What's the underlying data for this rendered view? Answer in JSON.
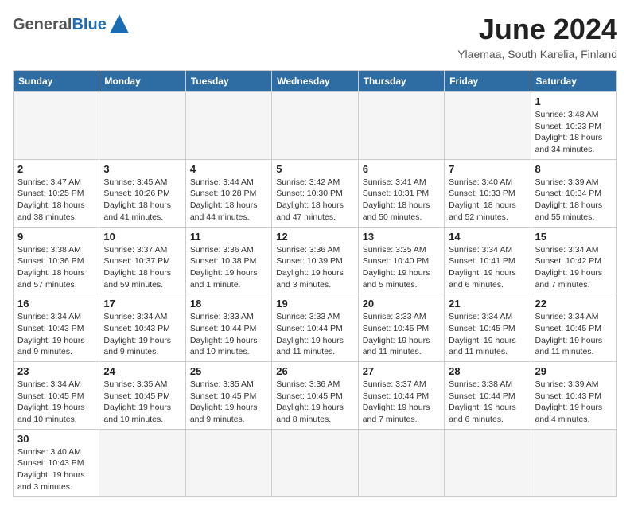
{
  "header": {
    "month_year": "June 2024",
    "location": "Ylaemaa, South Karelia, Finland",
    "logo_general": "General",
    "logo_blue": "Blue"
  },
  "weekdays": [
    "Sunday",
    "Monday",
    "Tuesday",
    "Wednesday",
    "Thursday",
    "Friday",
    "Saturday"
  ],
  "days": [
    {
      "day": "",
      "sunrise": "",
      "sunset": "",
      "daylight": "",
      "empty": true
    },
    {
      "day": "",
      "sunrise": "",
      "sunset": "",
      "daylight": "",
      "empty": true
    },
    {
      "day": "",
      "sunrise": "",
      "sunset": "",
      "daylight": "",
      "empty": true
    },
    {
      "day": "",
      "sunrise": "",
      "sunset": "",
      "daylight": "",
      "empty": true
    },
    {
      "day": "",
      "sunrise": "",
      "sunset": "",
      "daylight": "",
      "empty": true
    },
    {
      "day": "",
      "sunrise": "",
      "sunset": "",
      "daylight": "",
      "empty": true
    },
    {
      "day": "1",
      "sunrise": "Sunrise: 3:48 AM",
      "sunset": "Sunset: 10:23 PM",
      "daylight": "Daylight: 18 hours and 34 minutes.",
      "empty": false
    },
    {
      "day": "2",
      "sunrise": "Sunrise: 3:47 AM",
      "sunset": "Sunset: 10:25 PM",
      "daylight": "Daylight: 18 hours and 38 minutes.",
      "empty": false
    },
    {
      "day": "3",
      "sunrise": "Sunrise: 3:45 AM",
      "sunset": "Sunset: 10:26 PM",
      "daylight": "Daylight: 18 hours and 41 minutes.",
      "empty": false
    },
    {
      "day": "4",
      "sunrise": "Sunrise: 3:44 AM",
      "sunset": "Sunset: 10:28 PM",
      "daylight": "Daylight: 18 hours and 44 minutes.",
      "empty": false
    },
    {
      "day": "5",
      "sunrise": "Sunrise: 3:42 AM",
      "sunset": "Sunset: 10:30 PM",
      "daylight": "Daylight: 18 hours and 47 minutes.",
      "empty": false
    },
    {
      "day": "6",
      "sunrise": "Sunrise: 3:41 AM",
      "sunset": "Sunset: 10:31 PM",
      "daylight": "Daylight: 18 hours and 50 minutes.",
      "empty": false
    },
    {
      "day": "7",
      "sunrise": "Sunrise: 3:40 AM",
      "sunset": "Sunset: 10:33 PM",
      "daylight": "Daylight: 18 hours and 52 minutes.",
      "empty": false
    },
    {
      "day": "8",
      "sunrise": "Sunrise: 3:39 AM",
      "sunset": "Sunset: 10:34 PM",
      "daylight": "Daylight: 18 hours and 55 minutes.",
      "empty": false
    },
    {
      "day": "9",
      "sunrise": "Sunrise: 3:38 AM",
      "sunset": "Sunset: 10:36 PM",
      "daylight": "Daylight: 18 hours and 57 minutes.",
      "empty": false
    },
    {
      "day": "10",
      "sunrise": "Sunrise: 3:37 AM",
      "sunset": "Sunset: 10:37 PM",
      "daylight": "Daylight: 18 hours and 59 minutes.",
      "empty": false
    },
    {
      "day": "11",
      "sunrise": "Sunrise: 3:36 AM",
      "sunset": "Sunset: 10:38 PM",
      "daylight": "Daylight: 19 hours and 1 minute.",
      "empty": false
    },
    {
      "day": "12",
      "sunrise": "Sunrise: 3:36 AM",
      "sunset": "Sunset: 10:39 PM",
      "daylight": "Daylight: 19 hours and 3 minutes.",
      "empty": false
    },
    {
      "day": "13",
      "sunrise": "Sunrise: 3:35 AM",
      "sunset": "Sunset: 10:40 PM",
      "daylight": "Daylight: 19 hours and 5 minutes.",
      "empty": false
    },
    {
      "day": "14",
      "sunrise": "Sunrise: 3:34 AM",
      "sunset": "Sunset: 10:41 PM",
      "daylight": "Daylight: 19 hours and 6 minutes.",
      "empty": false
    },
    {
      "day": "15",
      "sunrise": "Sunrise: 3:34 AM",
      "sunset": "Sunset: 10:42 PM",
      "daylight": "Daylight: 19 hours and 7 minutes.",
      "empty": false
    },
    {
      "day": "16",
      "sunrise": "Sunrise: 3:34 AM",
      "sunset": "Sunset: 10:43 PM",
      "daylight": "Daylight: 19 hours and 9 minutes.",
      "empty": false
    },
    {
      "day": "17",
      "sunrise": "Sunrise: 3:34 AM",
      "sunset": "Sunset: 10:43 PM",
      "daylight": "Daylight: 19 hours and 9 minutes.",
      "empty": false
    },
    {
      "day": "18",
      "sunrise": "Sunrise: 3:33 AM",
      "sunset": "Sunset: 10:44 PM",
      "daylight": "Daylight: 19 hours and 10 minutes.",
      "empty": false
    },
    {
      "day": "19",
      "sunrise": "Sunrise: 3:33 AM",
      "sunset": "Sunset: 10:44 PM",
      "daylight": "Daylight: 19 hours and 11 minutes.",
      "empty": false
    },
    {
      "day": "20",
      "sunrise": "Sunrise: 3:33 AM",
      "sunset": "Sunset: 10:45 PM",
      "daylight": "Daylight: 19 hours and 11 minutes.",
      "empty": false
    },
    {
      "day": "21",
      "sunrise": "Sunrise: 3:34 AM",
      "sunset": "Sunset: 10:45 PM",
      "daylight": "Daylight: 19 hours and 11 minutes.",
      "empty": false
    },
    {
      "day": "22",
      "sunrise": "Sunrise: 3:34 AM",
      "sunset": "Sunset: 10:45 PM",
      "daylight": "Daylight: 19 hours and 11 minutes.",
      "empty": false
    },
    {
      "day": "23",
      "sunrise": "Sunrise: 3:34 AM",
      "sunset": "Sunset: 10:45 PM",
      "daylight": "Daylight: 19 hours and 10 minutes.",
      "empty": false
    },
    {
      "day": "24",
      "sunrise": "Sunrise: 3:35 AM",
      "sunset": "Sunset: 10:45 PM",
      "daylight": "Daylight: 19 hours and 10 minutes.",
      "empty": false
    },
    {
      "day": "25",
      "sunrise": "Sunrise: 3:35 AM",
      "sunset": "Sunset: 10:45 PM",
      "daylight": "Daylight: 19 hours and 9 minutes.",
      "empty": false
    },
    {
      "day": "26",
      "sunrise": "Sunrise: 3:36 AM",
      "sunset": "Sunset: 10:45 PM",
      "daylight": "Daylight: 19 hours and 8 minutes.",
      "empty": false
    },
    {
      "day": "27",
      "sunrise": "Sunrise: 3:37 AM",
      "sunset": "Sunset: 10:44 PM",
      "daylight": "Daylight: 19 hours and 7 minutes.",
      "empty": false
    },
    {
      "day": "28",
      "sunrise": "Sunrise: 3:38 AM",
      "sunset": "Sunset: 10:44 PM",
      "daylight": "Daylight: 19 hours and 6 minutes.",
      "empty": false
    },
    {
      "day": "29",
      "sunrise": "Sunrise: 3:39 AM",
      "sunset": "Sunset: 10:43 PM",
      "daylight": "Daylight: 19 hours and 4 minutes.",
      "empty": false
    },
    {
      "day": "30",
      "sunrise": "Sunrise: 3:40 AM",
      "sunset": "Sunset: 10:43 PM",
      "daylight": "Daylight: 19 hours and 3 minutes.",
      "empty": false
    }
  ]
}
